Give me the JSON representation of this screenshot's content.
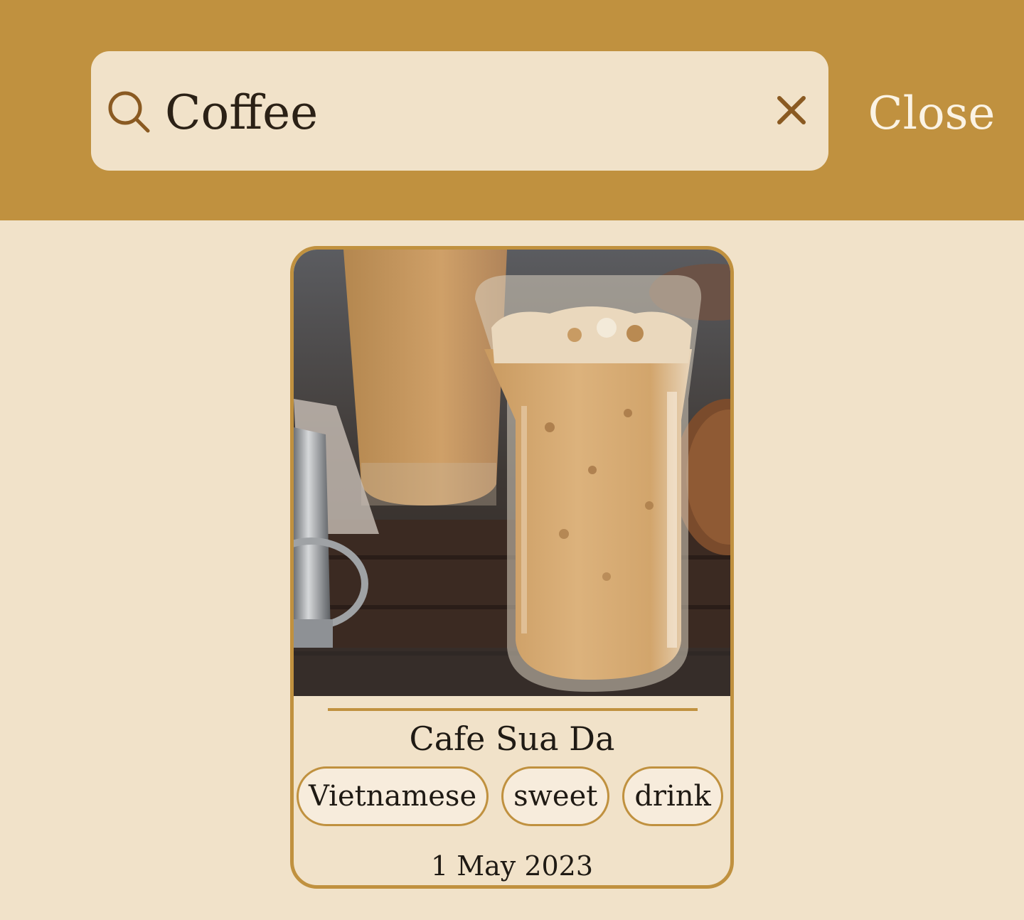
{
  "search": {
    "value": "Coffee",
    "close_label": "Close"
  },
  "results": [
    {
      "title": "Cafe Sua Da",
      "tags": [
        "Vietnamese",
        "sweet",
        "drink",
        ""
      ],
      "date": "1 May 2023",
      "image_icon": "iced-coffee-photo"
    }
  ],
  "colors": {
    "accent": "#c0913f",
    "background": "#f1e2c9",
    "tag_background": "#f7ecdc",
    "text": "#1f1a14"
  }
}
